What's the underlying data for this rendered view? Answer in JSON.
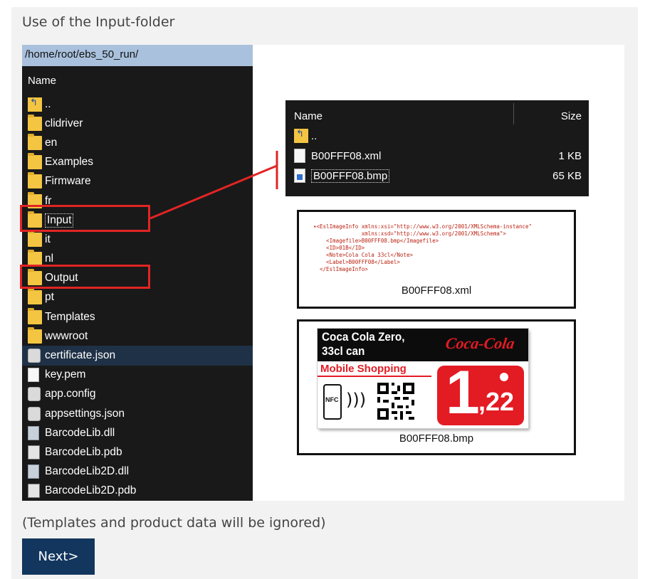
{
  "heading": "Use of the Input-folder",
  "footnote": "(Templates and product data will be ignored)",
  "next_button": "Next>",
  "explorer": {
    "path": "/home/root/ebs_50_run/",
    "column_name": "Name",
    "items": [
      {
        "label": "..",
        "icon": "folder-up-icon"
      },
      {
        "label": "clidriver",
        "icon": "folder-icon"
      },
      {
        "label": "en",
        "icon": "folder-icon"
      },
      {
        "label": "Examples",
        "icon": "folder-icon"
      },
      {
        "label": "Firmware",
        "icon": "folder-icon"
      },
      {
        "label": "fr",
        "icon": "folder-icon"
      },
      {
        "label": "Input",
        "icon": "folder-icon"
      },
      {
        "label": "it",
        "icon": "folder-icon"
      },
      {
        "label": "nl",
        "icon": "folder-icon"
      },
      {
        "label": "Output",
        "icon": "folder-icon"
      },
      {
        "label": "pt",
        "icon": "folder-icon"
      },
      {
        "label": "Templates",
        "icon": "folder-icon"
      },
      {
        "label": "wwwroot",
        "icon": "folder-icon"
      },
      {
        "label": "certificate.json",
        "icon": "json-file-icon"
      },
      {
        "label": "key.pem",
        "icon": "file-icon"
      },
      {
        "label": "app.config",
        "icon": "config-file-icon"
      },
      {
        "label": "appsettings.json",
        "icon": "json-file-icon"
      },
      {
        "label": "BarcodeLib.dll",
        "icon": "dll-file-icon"
      },
      {
        "label": "BarcodeLib.pdb",
        "icon": "pdb-file-icon"
      },
      {
        "label": "BarcodeLib2D.dll",
        "icon": "dll-file-icon"
      },
      {
        "label": "BarcodeLib2D.pdb",
        "icon": "pdb-file-icon"
      }
    ]
  },
  "input_folder": {
    "column_name": "Name",
    "column_size": "Size",
    "items": [
      {
        "label": "..",
        "size": "",
        "icon": "folder-up-icon"
      },
      {
        "label": "B00FFF08.xml",
        "size": "1 KB",
        "icon": "xml-file-icon"
      },
      {
        "label": "B00FFF08.bmp",
        "size": "65 KB",
        "icon": "bmp-file-icon"
      }
    ]
  },
  "xml_preview": {
    "lines": [
      "▾<EslImageInfo xmlns:xsi=\"http://www.w3.org/2001/XMLSchema-instance\"",
      "               xmlns:xsd=\"http://www.w3.org/2001/XMLSchema\">",
      "    <Imagefile>B00FFF08.bmp</Imagefile>",
      "    <ID>01B</ID>",
      "    <Note>Cola Cola 33cl</Note>",
      "    <Label>B00FFF08</Label>",
      "  </EslImageInfo>"
    ],
    "caption": "B00FFF08.xml"
  },
  "bmp_preview": {
    "product_name_line1": "Coca Cola Zero,",
    "product_name_line2": "33cl can",
    "brand": "Coca-Cola",
    "promo": "Mobile Shopping",
    "nfc": "NFC",
    "price_int": "1",
    "price_dec": ",22",
    "caption": "B00FFF08.bmp"
  },
  "colors": {
    "highlight": "#e22424",
    "button": "#12365e",
    "explorer_bg": "#191919",
    "path_bar": "#a9c1dc",
    "price_red": "#e31b23"
  }
}
